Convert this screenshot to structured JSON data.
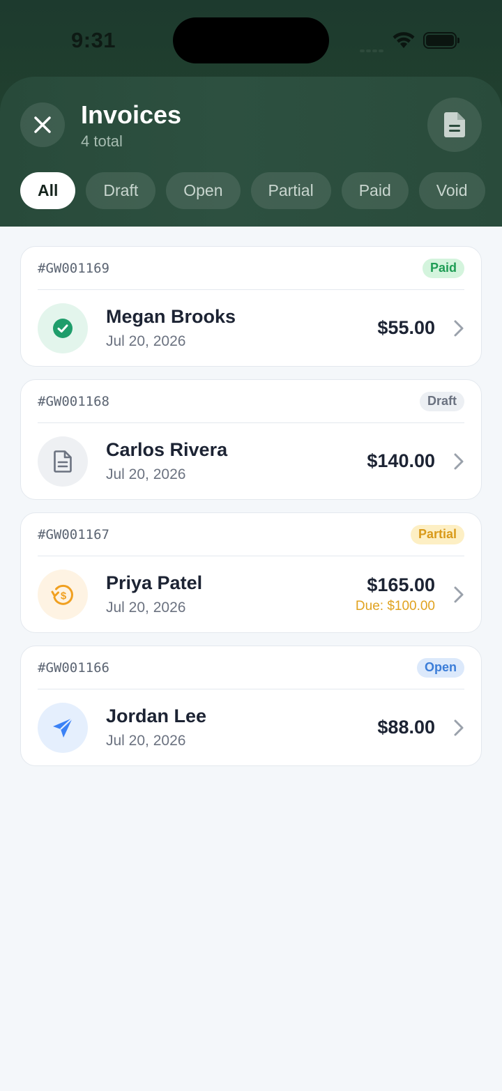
{
  "status_bar": {
    "time": "9:31"
  },
  "header": {
    "title": "Invoices",
    "subtitle": "4 total",
    "close_icon": "close-icon",
    "document_icon": "document-icon"
  },
  "filters": [
    {
      "label": "All",
      "active": true
    },
    {
      "label": "Draft",
      "active": false
    },
    {
      "label": "Open",
      "active": false
    },
    {
      "label": "Partial",
      "active": false
    },
    {
      "label": "Paid",
      "active": false
    },
    {
      "label": "Void",
      "active": false
    }
  ],
  "invoices": [
    {
      "number": "#GW001169",
      "status": "Paid",
      "customer": "Megan Brooks",
      "date": "Jul 20, 2026",
      "amount": "$55.00",
      "due": "",
      "icon": "check-circle-icon",
      "colors": {
        "badge_bg": "#d4f4dd",
        "badge_text": "#1f9d55",
        "avatar_bg": "#e3f5ec",
        "icon": "#1f9d6b"
      }
    },
    {
      "number": "#GW001168",
      "status": "Draft",
      "customer": "Carlos Rivera",
      "date": "Jul 20, 2026",
      "amount": "$140.00",
      "due": "",
      "icon": "document-icon",
      "colors": {
        "badge_bg": "#eceff3",
        "badge_text": "#6b7280",
        "avatar_bg": "#eef0f3",
        "icon": "#6b7280"
      }
    },
    {
      "number": "#GW001167",
      "status": "Partial",
      "customer": "Priya Patel",
      "date": "Jul 20, 2026",
      "amount": "$165.00",
      "due": "Due: $100.00",
      "icon": "partial-payment-icon",
      "colors": {
        "badge_bg": "#fdefc4",
        "badge_text": "#d99a1a",
        "avatar_bg": "#fef3e3",
        "icon": "#f0a020"
      }
    },
    {
      "number": "#GW001166",
      "status": "Open",
      "customer": "Jordan Lee",
      "date": "Jul 20, 2026",
      "amount": "$88.00",
      "due": "",
      "icon": "paper-plane-icon",
      "colors": {
        "badge_bg": "#dce9fb",
        "badge_text": "#3b7dd8",
        "avatar_bg": "#e5effd",
        "icon": "#3b82f6"
      }
    }
  ]
}
